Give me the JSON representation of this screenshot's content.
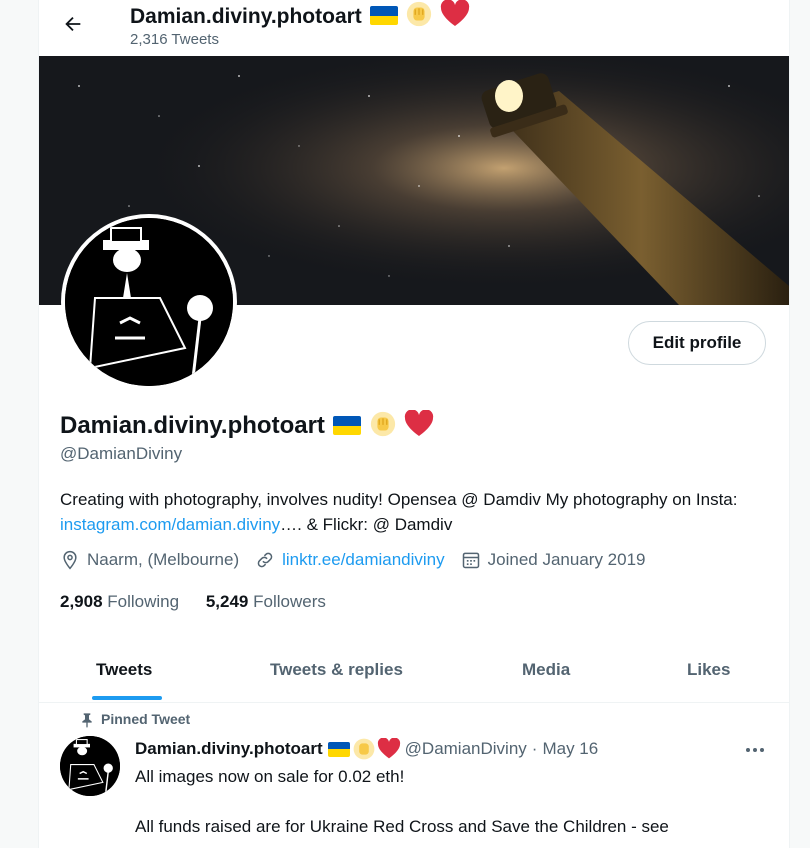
{
  "header": {
    "title": "Damian.diviny.photoart",
    "tweet_count": "2,316 Tweets"
  },
  "profile": {
    "name": "Damian.diviny.photoart",
    "handle": "@DamianDiviny",
    "edit_label": "Edit profile",
    "bio_part1": "Creating with photography, involves nudity! Opensea @ Damdiv My photography on Insta: ",
    "bio_link": "instagram.com/damian.diviny",
    "bio_part2": "…. & Flickr: @ Damdiv",
    "location": "Naarm, (Melbourne)",
    "website": "linktr.ee/damiandiviny",
    "joined": "Joined January 2019",
    "following_count": "2,908",
    "following_label": "Following",
    "followers_count": "5,249",
    "followers_label": "Followers"
  },
  "tabs": [
    {
      "label": "Tweets"
    },
    {
      "label": "Tweets & replies"
    },
    {
      "label": "Media"
    },
    {
      "label": "Likes"
    }
  ],
  "pinned_tweet": {
    "label": "Pinned Tweet",
    "author_name": "Damian.diviny.photoart",
    "author_handle": "@DamianDiviny",
    "separator": "·",
    "date": "May 16",
    "text": "All images now on sale for 0.02 eth!\n\nAll funds raised are for Ukraine Red Cross and Save the Children - see"
  },
  "colors": {
    "accent": "#1d9bf0",
    "text": "#0f1419",
    "muted": "#536471",
    "flag_blue": "#0057b7",
    "flag_yellow": "#ffd700",
    "heart": "#dd2e44"
  },
  "icons": [
    "back-arrow-icon",
    "ukraine-flag-icon",
    "raised-fist-icon",
    "red-heart-icon",
    "location-pin-icon",
    "link-icon",
    "calendar-icon",
    "pin-icon",
    "more-icon"
  ]
}
